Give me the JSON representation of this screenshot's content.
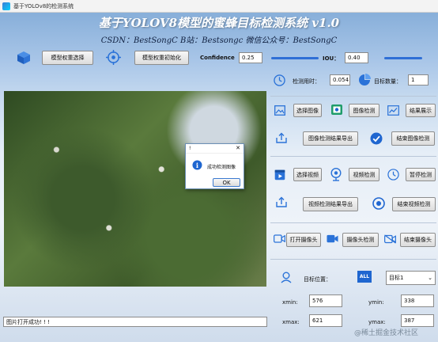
{
  "window": {
    "title": "基于YOLOv8的检测系统"
  },
  "header": {
    "title": "基于YOLOV8模型的蜜蜂目标检测系统 v1.0",
    "subtitle": "CSDN：BestSongC   B站：Bestsongc   微信公众号：BestSongC"
  },
  "toolbar": {
    "select_weights": "模型权重选择",
    "init_weights": "模型权重初始化",
    "confidence_label": "Confidence",
    "confidence_value": "0.25",
    "iou_label": "IOU：",
    "iou_value": "0.40"
  },
  "stats": {
    "time_label": "检测用时：",
    "time_value": "0.054",
    "count_label": "目标数量：",
    "count_value": "1"
  },
  "image_section": {
    "select": "选择图像",
    "detect": "图像检测",
    "show": "结果展示",
    "export": "图像检测结果导出",
    "end": "结束图像检测"
  },
  "video_section": {
    "select": "选择视频",
    "detect": "视频检测",
    "pause": "暂停检测",
    "export": "视频检测结果导出",
    "end": "结束视频检测"
  },
  "camera_section": {
    "open": "打开摄像头",
    "detect": "摄像头检测",
    "close": "结束摄像头"
  },
  "target": {
    "label": "目标位置：",
    "selected": "目标1",
    "xmin_label": "xmin:",
    "xmin_value": "576",
    "ymin_label": "ymin:",
    "ymin_value": "338",
    "xmax_label": "xmax:",
    "xmax_value": "621",
    "ymax_label": "ymax:",
    "ymax_value": "387"
  },
  "status": {
    "text": "图片打开成功! ! !"
  },
  "dialog": {
    "title": "!",
    "message": "成功检测图像",
    "ok": "OK"
  },
  "watermark": "@稀土掘金技术社区",
  "colors": {
    "accent": "#2f6fd6",
    "icon_blue": "#2a72d8"
  }
}
